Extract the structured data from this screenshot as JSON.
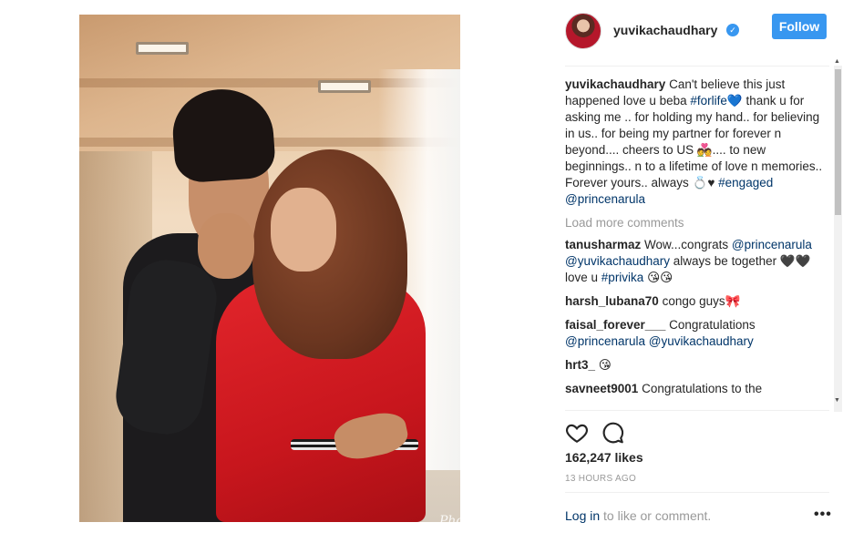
{
  "header": {
    "username": "yuvikachaudhary",
    "follow_label": "Follow",
    "verified_glyph": "✓"
  },
  "caption": {
    "user": "yuvikachaudhary",
    "text_1": "Can't believe this just happened love u beba",
    "hashtag_1": "#forlife",
    "emoji_1": "💙",
    "text_2": "thank u for asking me .. for holding my hand.. for believing in us.. for being my partner for forever n beyond.... cheers to US",
    "emoji_2": "💑",
    "text_3": ".... to new beginnings.. n to a lifetime of love n memories..",
    "text_4": "Forever yours.. always",
    "emoji_3": "💍♥",
    "hashtag_2": "#engaged",
    "mention": "@princenarula"
  },
  "load_more_label": "Load more comments",
  "comments": [
    {
      "user": "tanusharmaz",
      "text": "Wow...congrats",
      "mention_1": "@princenarula",
      "mention_2": "@yuvikachaudhary",
      "text_2": "always be together",
      "emoji_1": "🖤🖤",
      "text_3": "love u",
      "hashtag": "#privika",
      "emoji_2": "😘😘"
    },
    {
      "user": "harsh_lubana70",
      "text": "congo guys",
      "emoji": "🎀"
    },
    {
      "user": "faisal_forever___",
      "text": "Congratulations",
      "mention_1": "@princenarula",
      "mention_2": "@yuvikachaudhary"
    },
    {
      "user": "hrt3_",
      "emoji": "😘"
    },
    {
      "user": "savneet9001",
      "text": "Congratulations to the"
    }
  ],
  "likes_text": "162,247 likes",
  "timestamp": "13 HOURS AGO",
  "login": {
    "link": "Log in",
    "text": "to like or comment."
  },
  "more_glyph": "•••",
  "photo": {
    "watermark": "PhotoGrid"
  },
  "icons": {
    "heart": "heart-icon",
    "comment": "comment-icon",
    "verified": "verified-badge-icon"
  },
  "colors": {
    "accent": "#3897f0",
    "link": "#003569",
    "muted": "#999999"
  }
}
